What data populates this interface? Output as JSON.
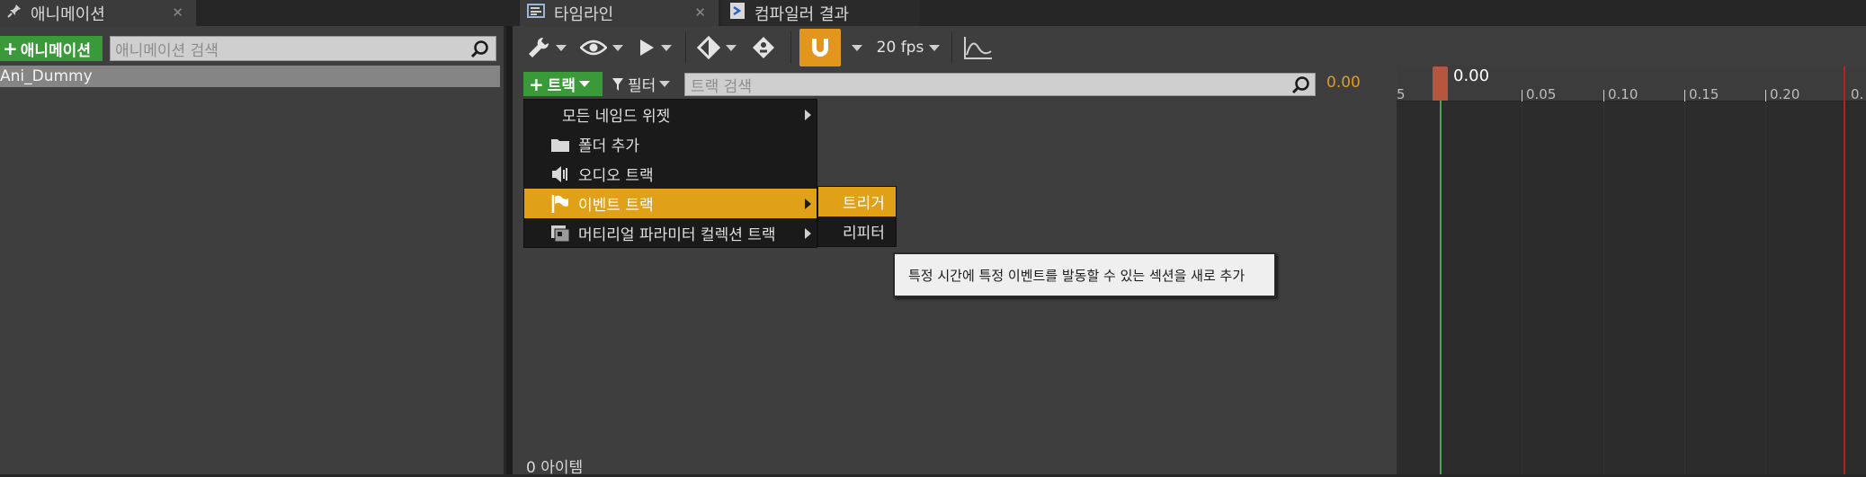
{
  "left_panel": {
    "tab_title": "애니메이션",
    "add_button_label": "애니메이션",
    "search_placeholder": "애니메이션 검색",
    "items": [
      "Ani_Dummy"
    ]
  },
  "sequencer": {
    "tab_title": "타임라인",
    "compile_tab_title": "컴파일러 결과",
    "fps_label": "20 fps",
    "track_button_label": "트랙",
    "filter_label": "필터",
    "track_search_placeholder": "트랙 검색",
    "current_time": "0.00",
    "item_count_text": "0 아이템"
  },
  "timeline": {
    "playhead_time": "0.00",
    "tick_labels": [
      "5",
      "0.05",
      "0.10",
      "0.15",
      "0.20",
      "0."
    ]
  },
  "track_menu": {
    "items": [
      {
        "label": "모든 네임드 위젯",
        "icon": "none",
        "has_submenu": true,
        "highlighted": false
      },
      {
        "label": "폴더 추가",
        "icon": "folder-icon",
        "has_submenu": false,
        "highlighted": false
      },
      {
        "label": "오디오 트랙",
        "icon": "speaker-icon",
        "has_submenu": false,
        "highlighted": false
      },
      {
        "label": "이벤트 트랙",
        "icon": "flag-icon",
        "has_submenu": true,
        "highlighted": true
      },
      {
        "label": "머티리얼 파라미터 컬렉션 트랙",
        "icon": "material-collection-icon",
        "has_submenu": true,
        "highlighted": false
      }
    ],
    "submenu": [
      {
        "label": "트리거",
        "highlighted": true
      },
      {
        "label": "리피터",
        "highlighted": false
      }
    ]
  },
  "tooltip": {
    "text": "특정 시간에 특정 이벤트를 발동할 수 있는 섹션을 새로 추가"
  },
  "colors": {
    "accent_orange": "#e0a018",
    "add_green": "#3a9a3a",
    "playhead_green": "#4aa44a",
    "end_marker_red": "#b52020"
  }
}
